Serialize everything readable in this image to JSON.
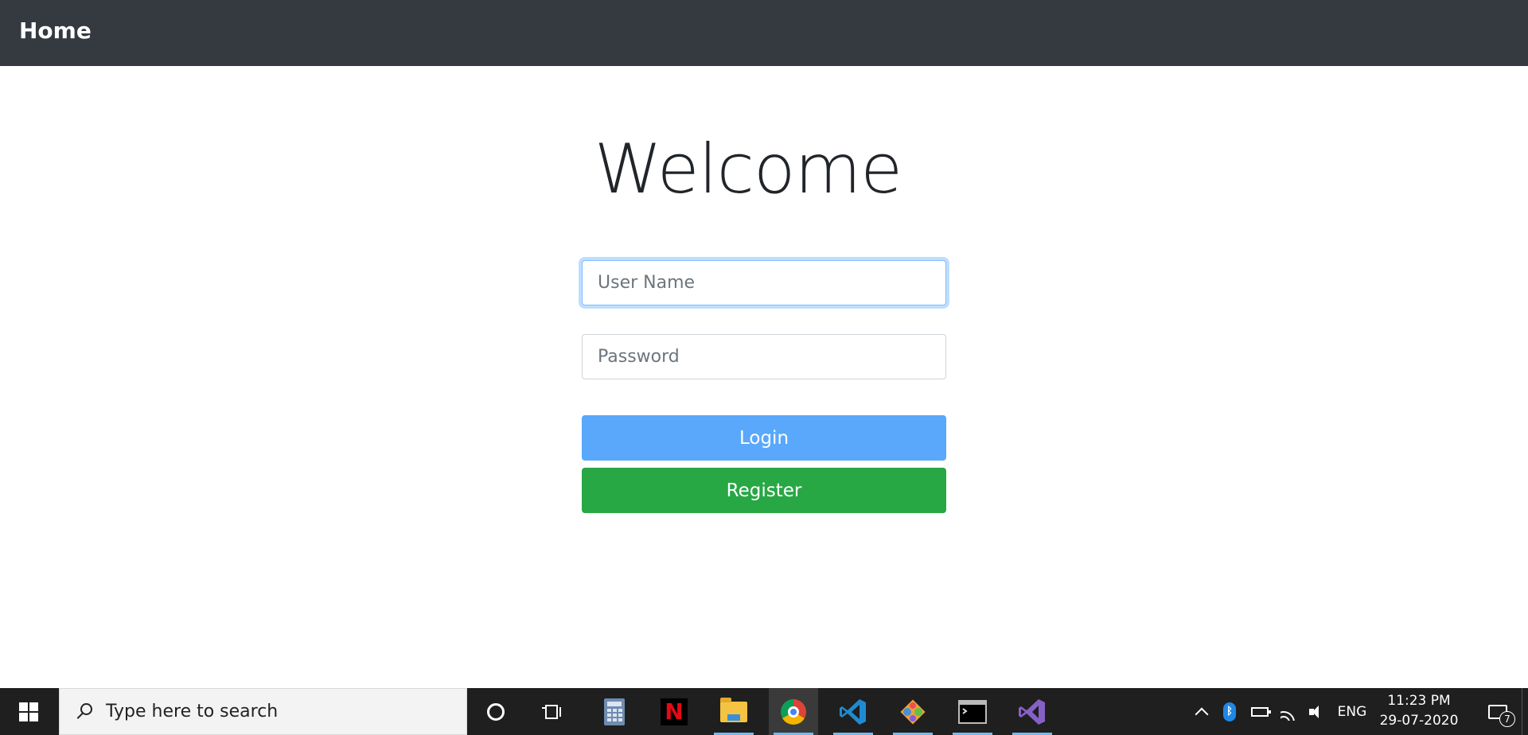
{
  "navbar": {
    "brand": "Home"
  },
  "main": {
    "heading": "Welcome",
    "username": {
      "placeholder": "User Name",
      "value": ""
    },
    "password": {
      "placeholder": "Password",
      "value": ""
    },
    "login_label": "Login",
    "register_label": "Register"
  },
  "colors": {
    "navbar": "#343a40",
    "login": "#59a8fb",
    "register": "#28a745",
    "taskbar": "#1f1f1f"
  },
  "taskbar": {
    "search_placeholder": "Type here to search",
    "apps": [
      "cortana-icon",
      "task-view-icon",
      "calculator-icon",
      "netflix-icon",
      "file-explorer-icon",
      "chrome-icon",
      "vscode-icon",
      "git-icon",
      "terminal-icon",
      "visual-studio-icon"
    ],
    "netflix_glyph": "N",
    "language": "ENG",
    "time": "11:23 PM",
    "date": "29-07-2020",
    "notification_count": "7"
  }
}
